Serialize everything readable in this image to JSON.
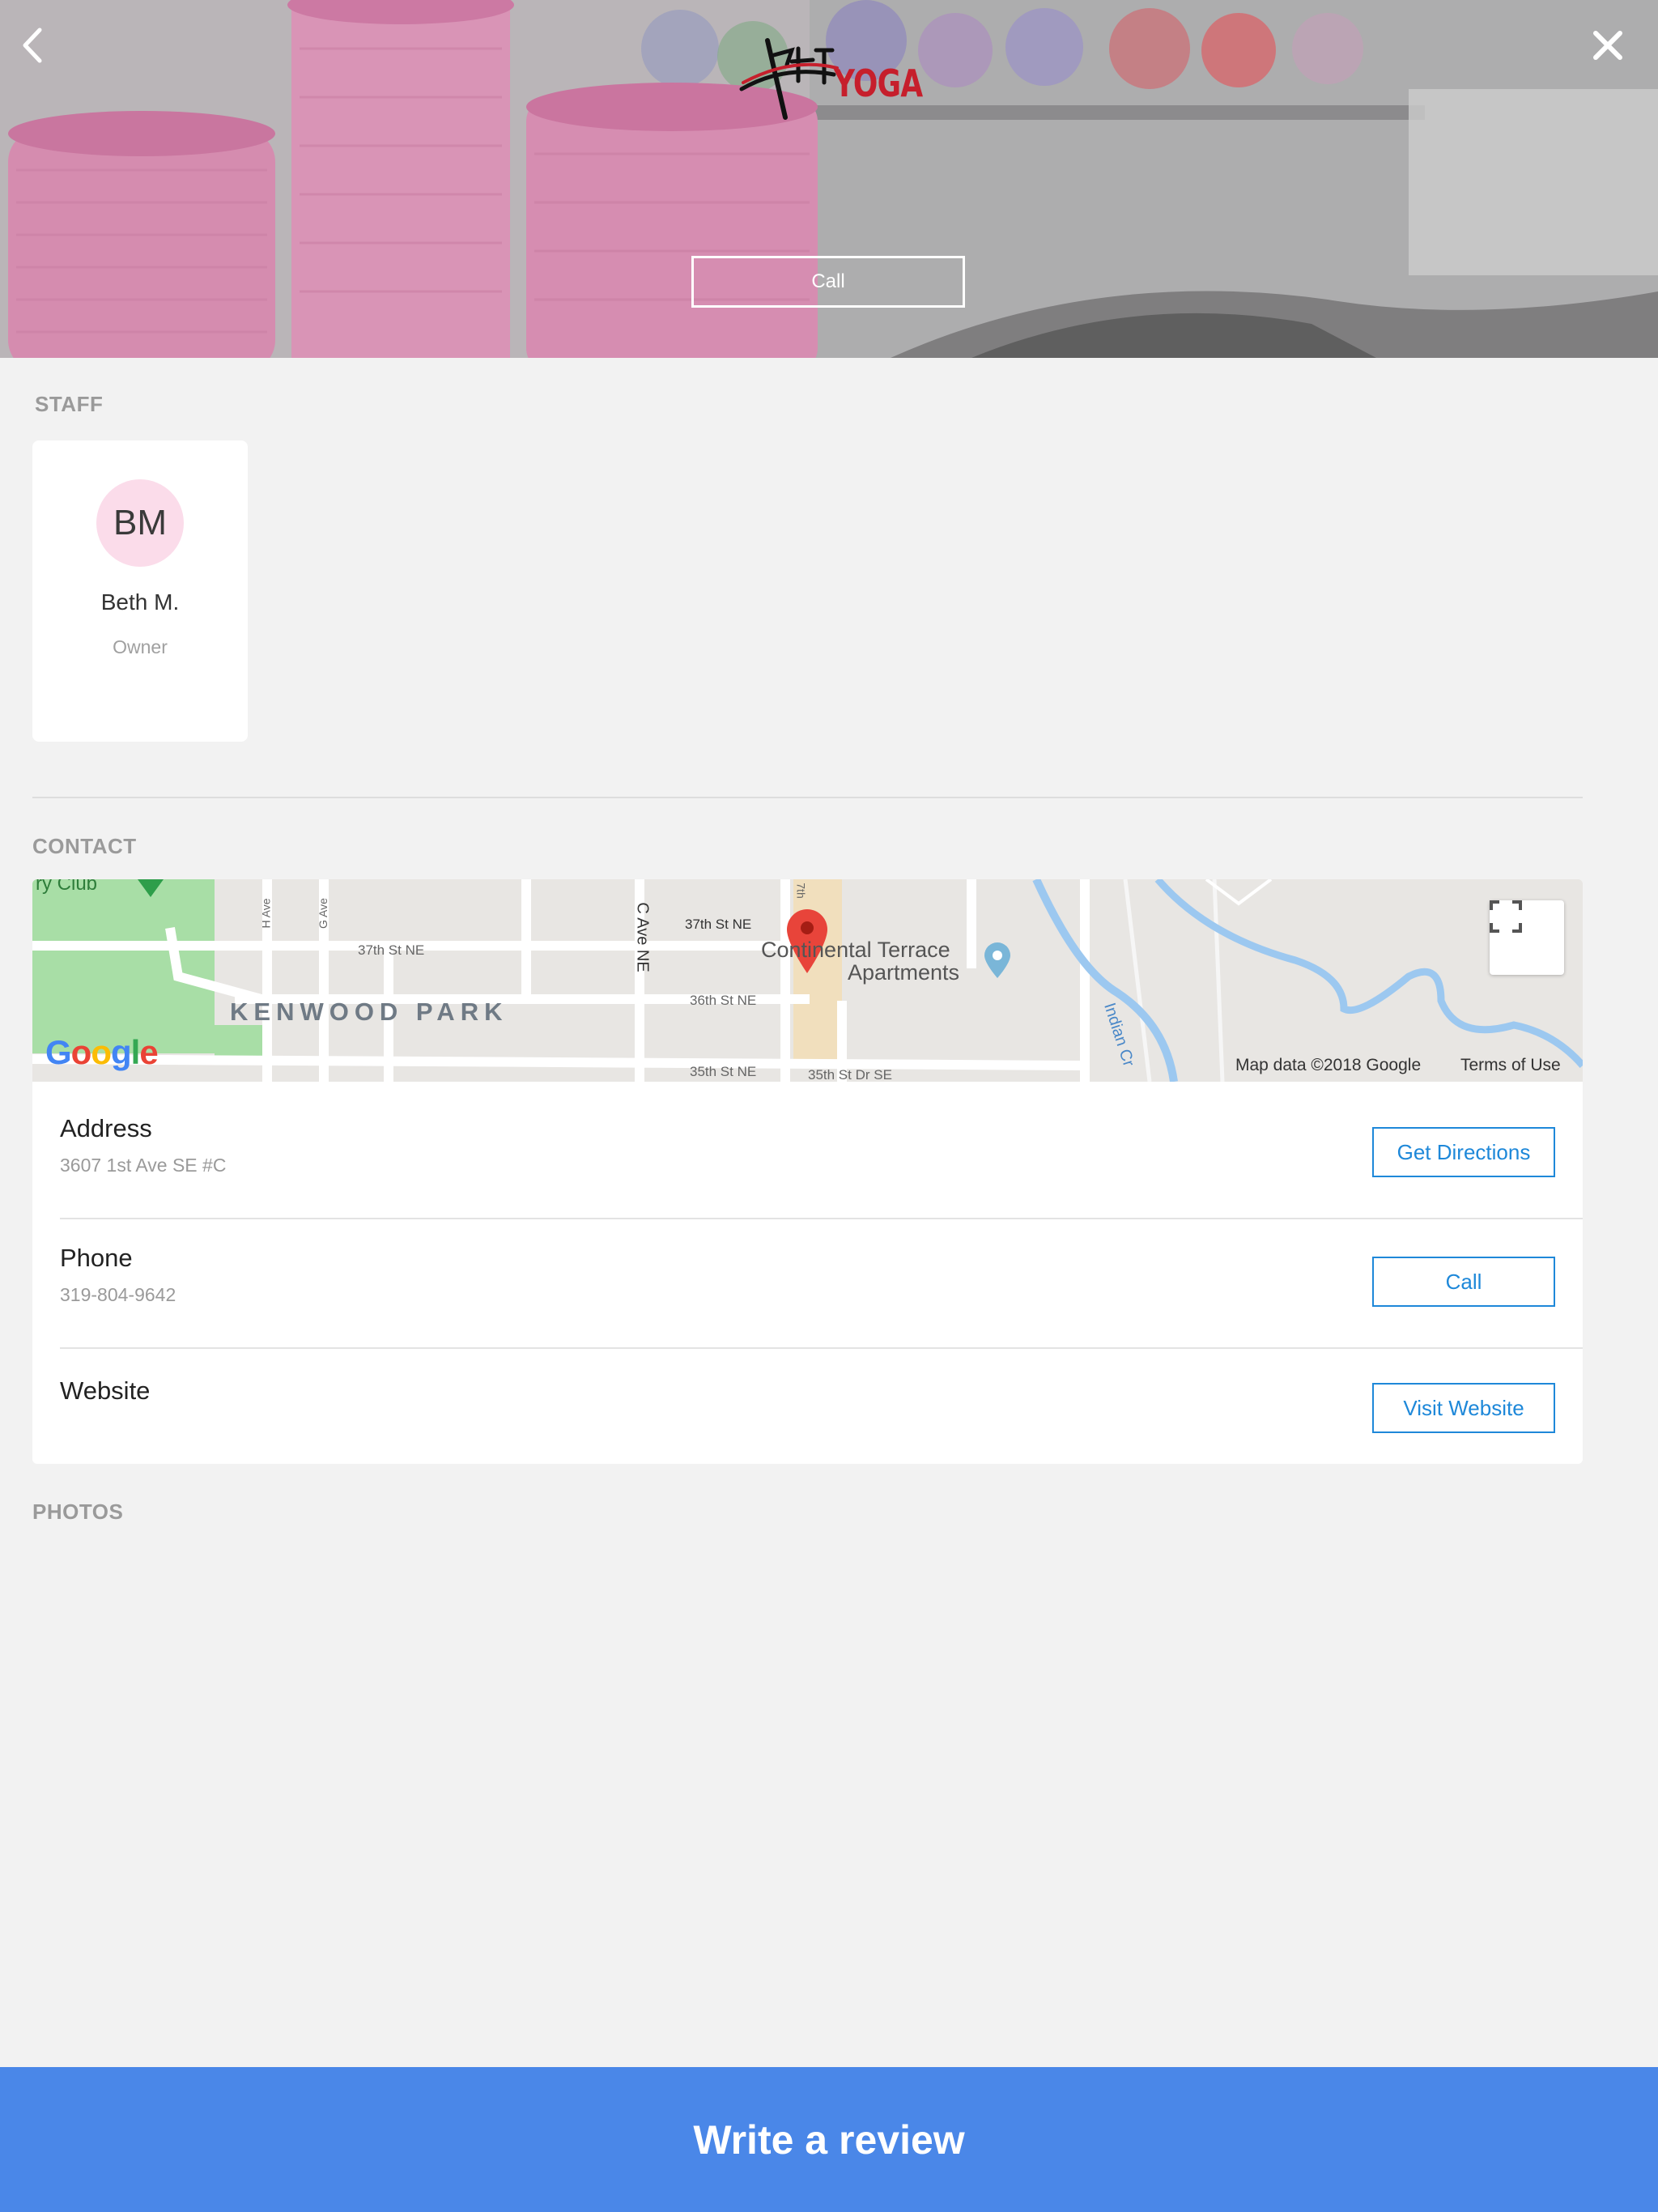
{
  "hero": {
    "logo_text": "YOGA",
    "call_label": "Call"
  },
  "staff": {
    "section_label": "STAFF",
    "members": [
      {
        "initials": "BM",
        "name": "Beth M.",
        "role": "Owner"
      }
    ]
  },
  "contact": {
    "section_label": "CONTACT",
    "map": {
      "labels": {
        "club": "ry Club",
        "h_ave": "H Ave",
        "g_ave": "G Ave",
        "st37_a": "37th St NE",
        "st37_b": "37th St NE",
        "c_ave": "C Ave NE",
        "st36": "36th St NE",
        "st35": "35th St NE",
        "st35dr": "35th St Dr SE",
        "st7": "7th",
        "neighborhood": "KENWOOD PARK",
        "poi_line1": "Continental Terrace",
        "poi_line2": "Apartments",
        "creek": "Indian Cr"
      },
      "google": [
        "G",
        "o",
        "o",
        "g",
        "l",
        "e"
      ],
      "data_text": "Map data ©2018 Google",
      "terms_text": "Terms of Use"
    },
    "rows": [
      {
        "title": "Address",
        "value": "3607 1st Ave SE #C",
        "button": "Get Directions"
      },
      {
        "title": "Phone",
        "value": "319-804-9642",
        "button": "Call"
      },
      {
        "title": "Website",
        "value": "",
        "button": "Visit Website"
      }
    ]
  },
  "photos": {
    "section_label": "PHOTOS"
  },
  "footer": {
    "review_label": "Write a review"
  },
  "colors": {
    "accent_blue": "#4a87e8",
    "link_blue": "#1e88d9",
    "logo_red": "#c61f2c",
    "avatar_pink": "#fbdcea"
  }
}
